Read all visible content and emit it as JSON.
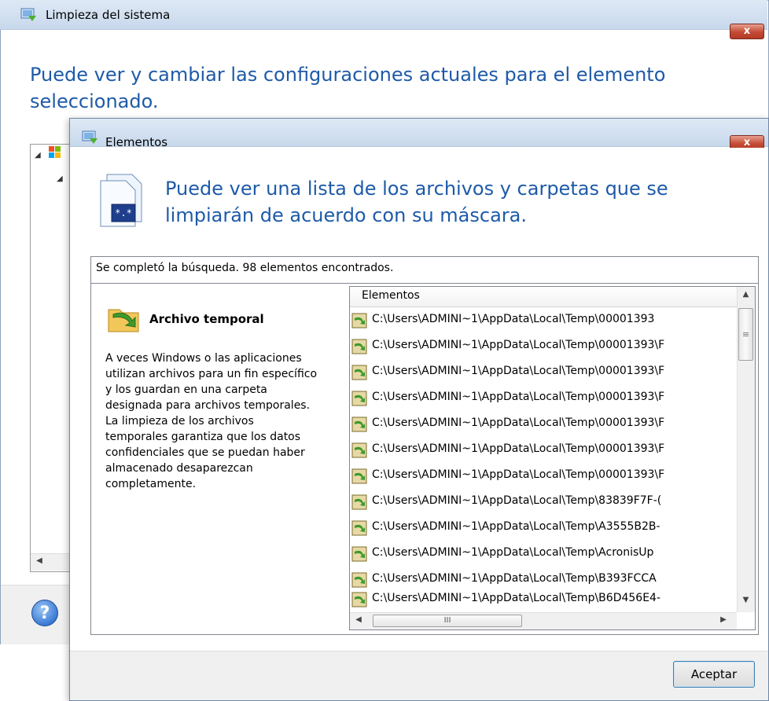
{
  "outer_window": {
    "title": "Limpieza del sistema",
    "close_label": "x",
    "heading": "Puede ver y cambiar las configuraciones actuales para el elemento seleccionado.",
    "help_label": "?"
  },
  "dialog": {
    "title": "Elementos",
    "close_label": "x",
    "heading": "Puede ver una lista de los archivos y carpetas que se limpiarán de acuerdo con su máscara.",
    "doc_icon_label": "*.*",
    "status": "Se completó la búsqueda. 98 elementos encontrados.",
    "item": {
      "name": "Archivo temporal",
      "description": "A veces Windows o las aplicaciones utilizan archivos para un fin específico y los guardan en una carpeta designada para archivos temporales. La limpieza de los archivos temporales garantiza que los datos confidenciales que se puedan haber almacenado desaparezcan completamente."
    },
    "list": {
      "column_header": "Elementos",
      "rows": [
        "C:\\Users\\ADMINI~1\\AppData\\Local\\Temp\\00001393",
        "C:\\Users\\ADMINI~1\\AppData\\Local\\Temp\\00001393\\F",
        "C:\\Users\\ADMINI~1\\AppData\\Local\\Temp\\00001393\\F",
        "C:\\Users\\ADMINI~1\\AppData\\Local\\Temp\\00001393\\F",
        "C:\\Users\\ADMINI~1\\AppData\\Local\\Temp\\00001393\\F",
        "C:\\Users\\ADMINI~1\\AppData\\Local\\Temp\\00001393\\F",
        "C:\\Users\\ADMINI~1\\AppData\\Local\\Temp\\00001393\\F",
        "C:\\Users\\ADMINI~1\\AppData\\Local\\Temp\\83839F7F-(",
        "C:\\Users\\ADMINI~1\\AppData\\Local\\Temp\\A3555B2B-",
        "C:\\Users\\ADMINI~1\\AppData\\Local\\Temp\\AcronisUp",
        "C:\\Users\\ADMINI~1\\AppData\\Local\\Temp\\B393FCCA",
        "C:\\Users\\ADMINI~1\\AppData\\Local\\Temp\\B6D456E4-"
      ]
    },
    "ok_button": "Aceptar"
  },
  "icons": {
    "window_icon": "system-cleanup-icon",
    "row_icon": "temp-file-icon",
    "item_icon": "temp-file-icon",
    "help_icon": "help-icon",
    "doc_icon": "document-mask-icon"
  },
  "colors": {
    "heading": "#1e5aa8",
    "title_bar": "#c7d8ec",
    "close_button": "#c44a34"
  }
}
